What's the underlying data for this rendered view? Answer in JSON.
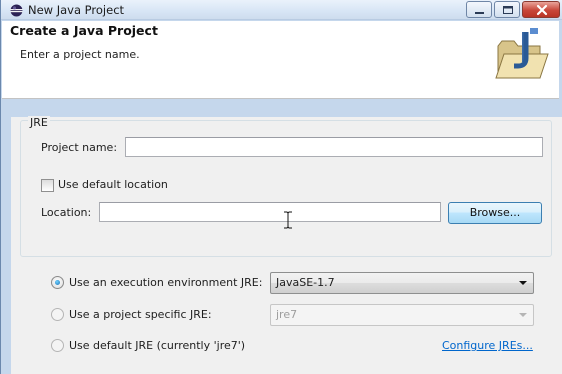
{
  "window": {
    "title": "New Java Project"
  },
  "banner": {
    "title": "Create a Java Project",
    "message": "Enter a project name."
  },
  "form": {
    "project_name_label": "Project name:",
    "project_name_value": "",
    "use_default_location_label": "Use default location",
    "use_default_location_checked": false,
    "location_label": "Location:",
    "location_value": "",
    "browse_label": "Browse..."
  },
  "jre": {
    "group_label": "JRE",
    "options": [
      {
        "label": "Use an execution environment JRE:",
        "selected": true,
        "value": "JavaSE-1.7",
        "enabled": true
      },
      {
        "label": "Use a project specific JRE:",
        "selected": false,
        "value": "jre7",
        "enabled": false
      },
      {
        "label": "Use default JRE (currently 'jre7')",
        "selected": false
      }
    ],
    "configure_link": "Configure JREs..."
  },
  "icons": {
    "window_icon": "eclipse-icon",
    "banner_icon": "java-project-folder-icon",
    "cursor": "text-cursor-icon"
  },
  "colors": {
    "link": "#0066cc",
    "close_button": "#c8473a",
    "window_frame": "#c5d7ec"
  }
}
